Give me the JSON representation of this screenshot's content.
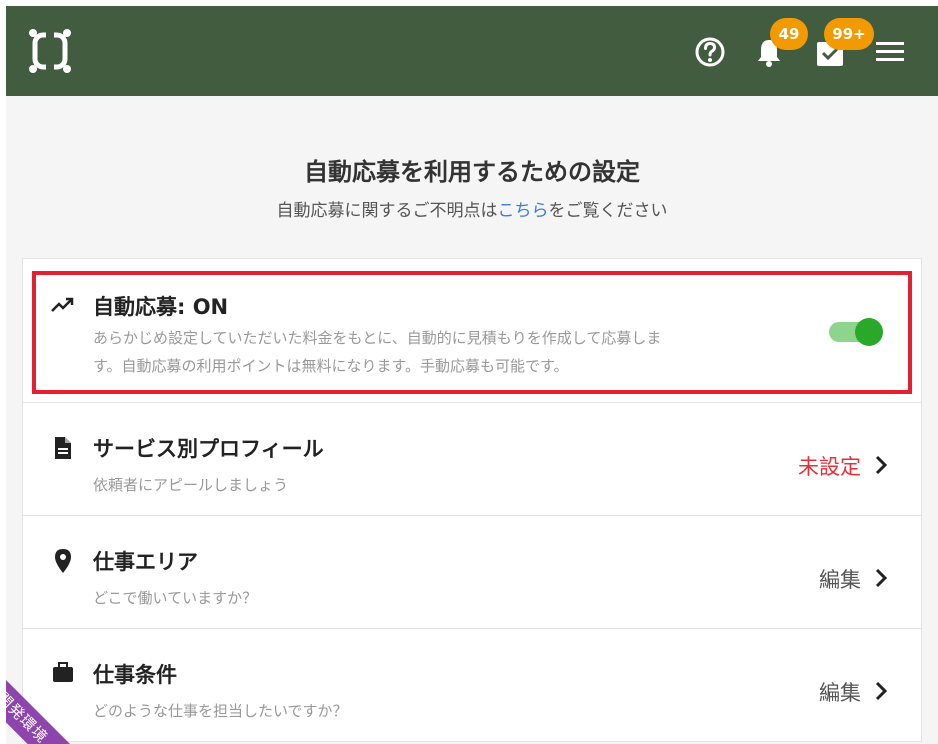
{
  "header": {
    "notifications_badge": "49",
    "tasks_badge": "99+"
  },
  "page": {
    "title": "自動応募を利用するための設定",
    "subtitle_prefix": "自動応募に関するご不明点は",
    "subtitle_link": "こちら",
    "subtitle_suffix": "をご覧ください"
  },
  "auto_apply": {
    "title": "自動応募: ON",
    "description_line1": "あらかじめ設定していただいた料金をもとに、自動的に見積もりを作成して応募しま",
    "description_line2": "す。自動応募の利用ポイントは無料になります。手動応募も可能です。",
    "enabled": true
  },
  "rows": [
    {
      "title": "サービス別プロフィール",
      "description": "依頼者にアピールしましょう",
      "action": "未設定",
      "icon": "document-icon"
    },
    {
      "title": "仕事エリア",
      "description": "どこで働いていますか？",
      "action": "編集",
      "icon": "location-pin-icon"
    },
    {
      "title": "仕事条件",
      "description": "どのような仕事を担当したいですか？",
      "action": "編集",
      "icon": "briefcase-icon"
    }
  ],
  "env_ribbon": "開発環境",
  "colors": {
    "header_bg": "#425c40",
    "badge": "#f29a02",
    "toggle_on": "#29a82a",
    "highlight_border": "#e5202e",
    "unset_text": "#e5303a",
    "link": "#3a7bd5",
    "ribbon": "#8e44ad"
  }
}
